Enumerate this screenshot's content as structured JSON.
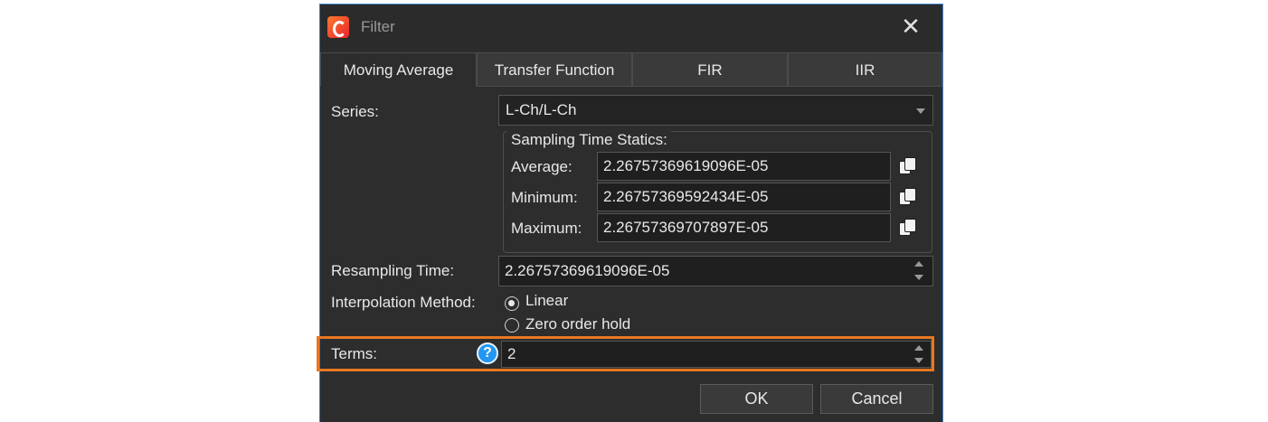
{
  "window": {
    "title": "Filter"
  },
  "tabs": [
    {
      "label": "Moving Average",
      "active": true
    },
    {
      "label": "Transfer Function",
      "active": false
    },
    {
      "label": "FIR",
      "active": false
    },
    {
      "label": "IIR",
      "active": false
    }
  ],
  "series": {
    "label": "Series:",
    "value": "L-Ch/L-Ch"
  },
  "sampling": {
    "group_title": "Sampling Time Statics:",
    "average": {
      "label": "Average:",
      "value": "2.26757369619096E-05"
    },
    "minimum": {
      "label": "Minimum:",
      "value": "2.26757369592434E-05"
    },
    "maximum": {
      "label": "Maximum:",
      "value": "2.26757369707897E-05"
    }
  },
  "resampling": {
    "label": "Resampling Time:",
    "value": "2.26757369619096E-05"
  },
  "interpolation": {
    "label": "Interpolation Method:",
    "options": [
      {
        "label": "Linear",
        "selected": true
      },
      {
        "label": "Zero order hold",
        "selected": false
      }
    ]
  },
  "terms": {
    "label": "Terms:",
    "value": "2"
  },
  "buttons": {
    "ok": "OK",
    "cancel": "Cancel"
  },
  "colors": {
    "highlight": "#e87722",
    "help": "#2196f3",
    "border_accent": "#3c7fc4"
  }
}
